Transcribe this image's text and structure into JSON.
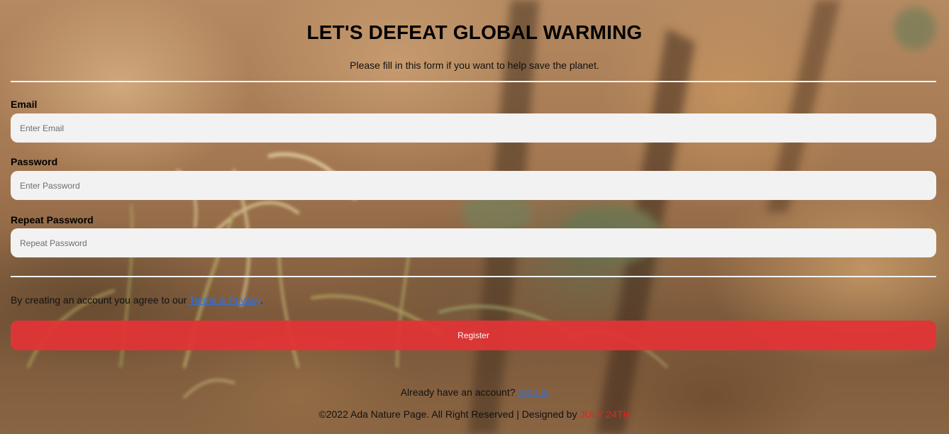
{
  "header": {
    "title": "LET'S DEFEAT GLOBAL WARMING",
    "subtitle": "Please fill in this form if you want to help save the planet."
  },
  "form": {
    "email": {
      "label": "Email",
      "placeholder": "Enter Email",
      "value": ""
    },
    "password": {
      "label": "Password",
      "placeholder": "Enter Password",
      "value": ""
    },
    "repeat_password": {
      "label": "Repeat Password",
      "placeholder": "Repeat Password",
      "value": ""
    },
    "terms_prefix": "By creating an account you agree to our ",
    "terms_link": "Terms & Privacy",
    "terms_suffix": ".",
    "register_label": "Register"
  },
  "signin": {
    "prefix": "Already have an account? ",
    "link": "Sign in"
  },
  "footer": {
    "text": "©2022 Ada Nature Page. All Right Reserved | Designed by ",
    "designer": "JULY 24TH"
  },
  "colors": {
    "register_button": "#e03536",
    "link": "#2a73e8",
    "designer": "#e0261e",
    "input_background": "#f2f2f2"
  }
}
